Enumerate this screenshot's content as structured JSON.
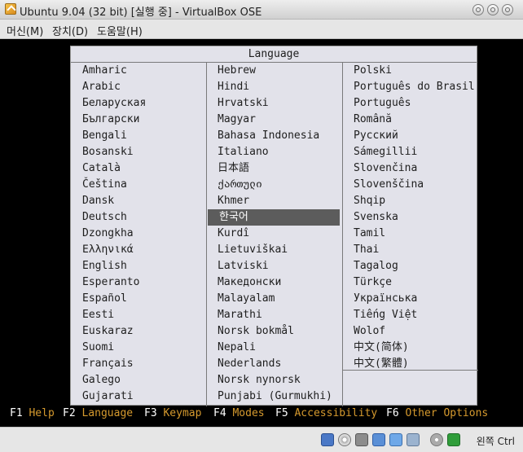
{
  "window": {
    "title": "Ubuntu 9.04 (32 bit) [실행 중] - VirtualBox OSE"
  },
  "menubar": {
    "items": [
      "머신(M)",
      "장치(D)",
      "도움말(H)"
    ]
  },
  "installer": {
    "title": "Language",
    "columns": [
      [
        "Amharic",
        "Arabic",
        "Беларуская",
        "Български",
        "Bengali",
        "Bosanski",
        "Català",
        "Čeština",
        "Dansk",
        "Deutsch",
        "Dzongkha",
        "Ελληνικά",
        "English",
        "Esperanto",
        "Español",
        "Eesti",
        "Euskaraz",
        "Suomi",
        "Français",
        "Galego",
        "Gujarati"
      ],
      [
        "Hebrew",
        "Hindi",
        "Hrvatski",
        "Magyar",
        "Bahasa Indonesia",
        "Italiano",
        "日本語",
        "ქართული",
        "Khmer",
        "한국어",
        "Kurdî",
        "Lietuviškai",
        "Latviski",
        "Македонски",
        "Malayalam",
        "Marathi",
        "Norsk bokmål",
        "Nepali",
        "Nederlands",
        "Norsk nynorsk",
        "Punjabi (Gurmukhi)"
      ],
      [
        "Polski",
        "Português do Brasil",
        "Português",
        "Română",
        "Русский",
        "Sámegillii",
        "Slovenčina",
        "Slovenščina",
        "Shqip",
        "Svenska",
        "Tamil",
        "Thai",
        "Tagalog",
        "Türkçe",
        "Українська",
        "Tiếng Việt",
        "Wolof",
        "中文(简体)",
        "中文(繁體)"
      ]
    ],
    "selected": "한국어",
    "function_keys": [
      {
        "key": "F1",
        "label": "Help"
      },
      {
        "key": "F2",
        "label": "Language"
      },
      {
        "key": "F3",
        "label": "Keymap"
      },
      {
        "key": "F4",
        "label": "Modes"
      },
      {
        "key": "F5",
        "label": "Accessibility"
      },
      {
        "key": "F6",
        "label": "Other Options"
      }
    ]
  },
  "statusbar": {
    "host_key": "왼쪽 Ctrl",
    "icons": [
      "hard-disk-icon",
      "cd-icon",
      "floppy-icon",
      "network-icon",
      "shared-folder-icon",
      "usb-icon",
      "mouse-integration-icon",
      "host-key-icon"
    ]
  }
}
